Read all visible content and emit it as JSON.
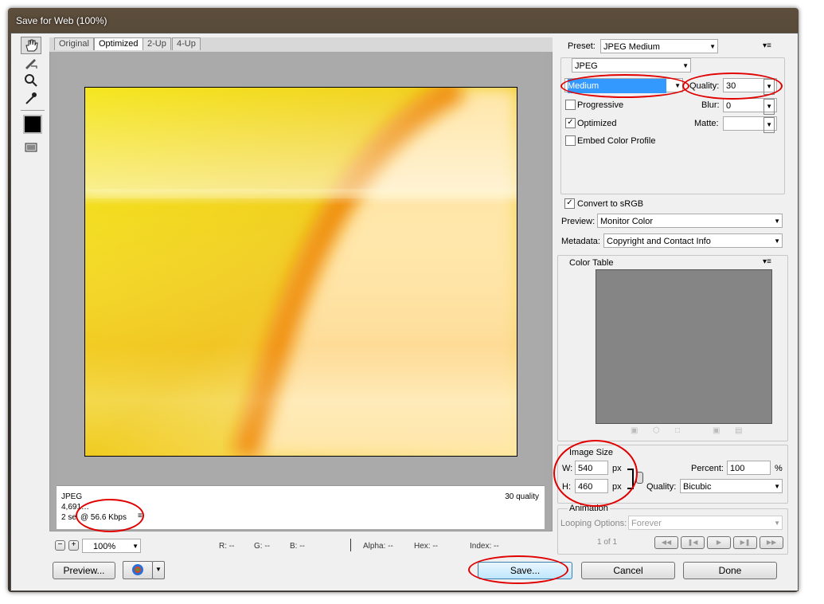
{
  "window": {
    "title": "Save for Web (100%)"
  },
  "tabs": [
    "Original",
    "Optimized",
    "2-Up",
    "4-Up"
  ],
  "info": {
    "format": "JPEG",
    "size": "4,691…",
    "time_prefix": "2 se",
    "rate": "@ 56.6 Kbps",
    "quality": "30 quality"
  },
  "zoom": "100%",
  "readout": {
    "r": "R: --",
    "g": "G: --",
    "b": "B: --",
    "alpha": "Alpha: --",
    "hex": "Hex: --",
    "index": "Index: --"
  },
  "buttons": {
    "preview": "Preview...",
    "save": "Save...",
    "cancel": "Cancel",
    "done": "Done"
  },
  "settings": {
    "preset_label": "Preset:",
    "preset": "JPEG Medium",
    "format": "JPEG",
    "compression": "Medium",
    "quality_label": "Quality:",
    "quality": "30",
    "progressive": "Progressive",
    "blur_label": "Blur:",
    "blur": "0",
    "optimized": "Optimized",
    "matte_label": "Matte:",
    "embed": "Embed Color Profile",
    "convert": "Convert to sRGB",
    "preview_label": "Preview:",
    "preview_value": "Monitor Color",
    "metadata_label": "Metadata:",
    "metadata_value": "Copyright and Contact Info"
  },
  "checks": {
    "progressive": false,
    "optimized": true,
    "embed": false,
    "convert": true
  },
  "color_table": {
    "title": "Color Table"
  },
  "image_size": {
    "title": "Image Size",
    "w_label": "W:",
    "w": "540",
    "h_label": "H:",
    "h": "460",
    "unit": "px",
    "percent_label": "Percent:",
    "percent": "100",
    "percent_unit": "%",
    "quality_label": "Quality:",
    "quality": "Bicubic"
  },
  "animation": {
    "title": "Animation",
    "looping_label": "Looping Options:",
    "looping": "Forever",
    "frames": "1 of 1"
  }
}
